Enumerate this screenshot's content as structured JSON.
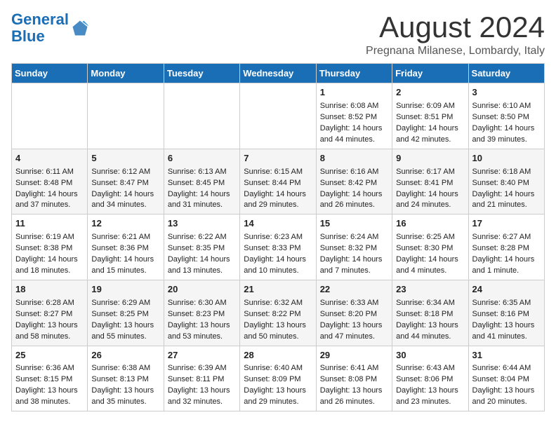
{
  "header": {
    "logo_line1": "General",
    "logo_line2": "Blue",
    "month_title": "August 2024",
    "location": "Pregnana Milanese, Lombardy, Italy"
  },
  "days_of_week": [
    "Sunday",
    "Monday",
    "Tuesday",
    "Wednesday",
    "Thursday",
    "Friday",
    "Saturday"
  ],
  "weeks": [
    [
      {
        "day": "",
        "data": ""
      },
      {
        "day": "",
        "data": ""
      },
      {
        "day": "",
        "data": ""
      },
      {
        "day": "",
        "data": ""
      },
      {
        "day": "1",
        "data": "Sunrise: 6:08 AM\nSunset: 8:52 PM\nDaylight: 14 hours and 44 minutes."
      },
      {
        "day": "2",
        "data": "Sunrise: 6:09 AM\nSunset: 8:51 PM\nDaylight: 14 hours and 42 minutes."
      },
      {
        "day": "3",
        "data": "Sunrise: 6:10 AM\nSunset: 8:50 PM\nDaylight: 14 hours and 39 minutes."
      }
    ],
    [
      {
        "day": "4",
        "data": "Sunrise: 6:11 AM\nSunset: 8:48 PM\nDaylight: 14 hours and 37 minutes."
      },
      {
        "day": "5",
        "data": "Sunrise: 6:12 AM\nSunset: 8:47 PM\nDaylight: 14 hours and 34 minutes."
      },
      {
        "day": "6",
        "data": "Sunrise: 6:13 AM\nSunset: 8:45 PM\nDaylight: 14 hours and 31 minutes."
      },
      {
        "day": "7",
        "data": "Sunrise: 6:15 AM\nSunset: 8:44 PM\nDaylight: 14 hours and 29 minutes."
      },
      {
        "day": "8",
        "data": "Sunrise: 6:16 AM\nSunset: 8:42 PM\nDaylight: 14 hours and 26 minutes."
      },
      {
        "day": "9",
        "data": "Sunrise: 6:17 AM\nSunset: 8:41 PM\nDaylight: 14 hours and 24 minutes."
      },
      {
        "day": "10",
        "data": "Sunrise: 6:18 AM\nSunset: 8:40 PM\nDaylight: 14 hours and 21 minutes."
      }
    ],
    [
      {
        "day": "11",
        "data": "Sunrise: 6:19 AM\nSunset: 8:38 PM\nDaylight: 14 hours and 18 minutes."
      },
      {
        "day": "12",
        "data": "Sunrise: 6:21 AM\nSunset: 8:36 PM\nDaylight: 14 hours and 15 minutes."
      },
      {
        "day": "13",
        "data": "Sunrise: 6:22 AM\nSunset: 8:35 PM\nDaylight: 14 hours and 13 minutes."
      },
      {
        "day": "14",
        "data": "Sunrise: 6:23 AM\nSunset: 8:33 PM\nDaylight: 14 hours and 10 minutes."
      },
      {
        "day": "15",
        "data": "Sunrise: 6:24 AM\nSunset: 8:32 PM\nDaylight: 14 hours and 7 minutes."
      },
      {
        "day": "16",
        "data": "Sunrise: 6:25 AM\nSunset: 8:30 PM\nDaylight: 14 hours and 4 minutes."
      },
      {
        "day": "17",
        "data": "Sunrise: 6:27 AM\nSunset: 8:28 PM\nDaylight: 14 hours and 1 minute."
      }
    ],
    [
      {
        "day": "18",
        "data": "Sunrise: 6:28 AM\nSunset: 8:27 PM\nDaylight: 13 hours and 58 minutes."
      },
      {
        "day": "19",
        "data": "Sunrise: 6:29 AM\nSunset: 8:25 PM\nDaylight: 13 hours and 55 minutes."
      },
      {
        "day": "20",
        "data": "Sunrise: 6:30 AM\nSunset: 8:23 PM\nDaylight: 13 hours and 53 minutes."
      },
      {
        "day": "21",
        "data": "Sunrise: 6:32 AM\nSunset: 8:22 PM\nDaylight: 13 hours and 50 minutes."
      },
      {
        "day": "22",
        "data": "Sunrise: 6:33 AM\nSunset: 8:20 PM\nDaylight: 13 hours and 47 minutes."
      },
      {
        "day": "23",
        "data": "Sunrise: 6:34 AM\nSunset: 8:18 PM\nDaylight: 13 hours and 44 minutes."
      },
      {
        "day": "24",
        "data": "Sunrise: 6:35 AM\nSunset: 8:16 PM\nDaylight: 13 hours and 41 minutes."
      }
    ],
    [
      {
        "day": "25",
        "data": "Sunrise: 6:36 AM\nSunset: 8:15 PM\nDaylight: 13 hours and 38 minutes."
      },
      {
        "day": "26",
        "data": "Sunrise: 6:38 AM\nSunset: 8:13 PM\nDaylight: 13 hours and 35 minutes."
      },
      {
        "day": "27",
        "data": "Sunrise: 6:39 AM\nSunset: 8:11 PM\nDaylight: 13 hours and 32 minutes."
      },
      {
        "day": "28",
        "data": "Sunrise: 6:40 AM\nSunset: 8:09 PM\nDaylight: 13 hours and 29 minutes."
      },
      {
        "day": "29",
        "data": "Sunrise: 6:41 AM\nSunset: 8:08 PM\nDaylight: 13 hours and 26 minutes."
      },
      {
        "day": "30",
        "data": "Sunrise: 6:43 AM\nSunset: 8:06 PM\nDaylight: 13 hours and 23 minutes."
      },
      {
        "day": "31",
        "data": "Sunrise: 6:44 AM\nSunset: 8:04 PM\nDaylight: 13 hours and 20 minutes."
      }
    ]
  ]
}
